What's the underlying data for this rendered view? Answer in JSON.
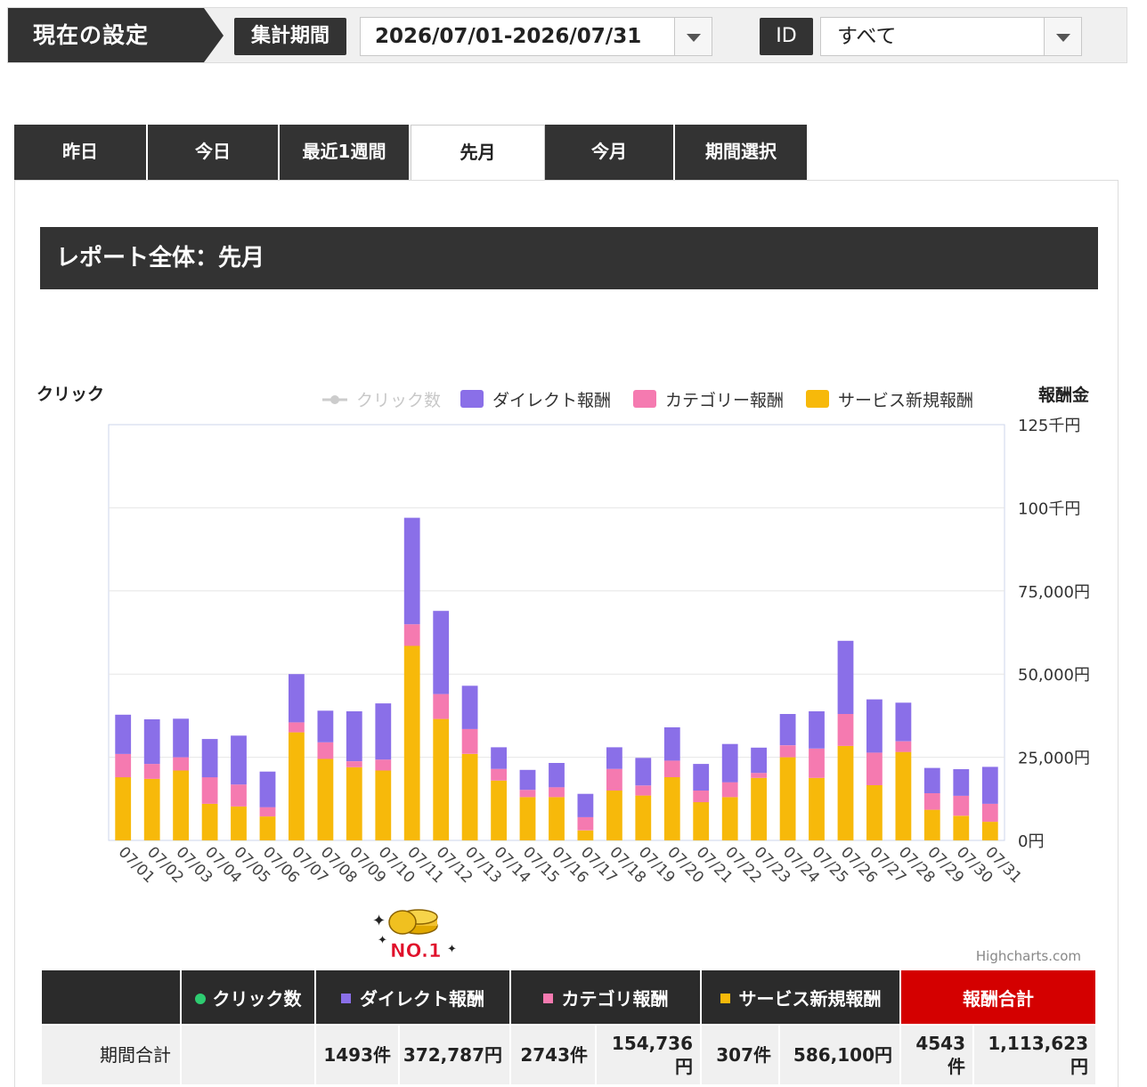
{
  "settings": {
    "current_label": "現在の設定",
    "period_label": "集計期間",
    "period_value": "2026/07/01-2026/07/31",
    "id_label": "ID",
    "id_value": "すべて"
  },
  "tabs": [
    {
      "label": "昨日",
      "active": false
    },
    {
      "label": "今日",
      "active": false
    },
    {
      "label": "最近1週間",
      "active": false
    },
    {
      "label": "先月",
      "active": true
    },
    {
      "label": "今月",
      "active": false
    },
    {
      "label": "期間選択",
      "active": false
    }
  ],
  "report_title": "レポート全体：先月",
  "colors": {
    "direct": "#8a6fe8",
    "category": "#f57ab0",
    "service": "#f7b90a",
    "clicks": "#bbbbbb"
  },
  "chart_data": {
    "type": "bar",
    "stacked": true,
    "left_axis_title": "クリック",
    "right_axis_title": "報酬金",
    "right_axis_ticks": [
      "0円",
      "25,000円",
      "50,000円",
      "75,000円",
      "100千円",
      "125千円"
    ],
    "ylim": [
      0,
      125000
    ],
    "grid": true,
    "legend_position": "top",
    "credit": "Highcharts.com",
    "categories": [
      "07/01",
      "07/02",
      "07/03",
      "07/04",
      "07/05",
      "07/06",
      "07/07",
      "07/08",
      "07/09",
      "07/10",
      "07/11",
      "07/12",
      "07/13",
      "07/14",
      "07/15",
      "07/16",
      "07/17",
      "07/18",
      "07/19",
      "07/20",
      "07/21",
      "07/22",
      "07/23",
      "07/24",
      "07/25",
      "07/26",
      "07/27",
      "07/28",
      "07/29",
      "07/30",
      "07/31"
    ],
    "series": [
      {
        "name": "クリック数",
        "type": "line",
        "hidden": true,
        "values": []
      },
      {
        "name": "サービス新規報酬",
        "values": [
          19000,
          18500,
          21000,
          11000,
          10200,
          7200,
          32500,
          24500,
          22000,
          21000,
          58500,
          36500,
          26000,
          18000,
          13000,
          13000,
          3000,
          15000,
          13500,
          19000,
          11500,
          13000,
          18800,
          25000,
          18800,
          28400,
          16600,
          26600,
          9200,
          7400,
          5600
        ]
      },
      {
        "name": "カテゴリー報酬",
        "values": [
          7000,
          4500,
          4000,
          8000,
          6600,
          2800,
          3000,
          5000,
          1800,
          3300,
          6500,
          7500,
          7500,
          3500,
          2200,
          3000,
          4000,
          6500,
          3000,
          5000,
          3500,
          4500,
          1500,
          3600,
          8800,
          9600,
          9800,
          3200,
          5000,
          6000,
          5400
        ]
      },
      {
        "name": "ダイレクト報酬",
        "values": [
          11800,
          13400,
          11600,
          11500,
          14700,
          10700,
          14500,
          9500,
          15000,
          16900,
          32000,
          25000,
          13000,
          6500,
          6000,
          7300,
          7000,
          6500,
          8300,
          10000,
          8000,
          11500,
          7600,
          9400,
          11200,
          22000,
          16000,
          11600,
          7600,
          8000,
          11100
        ]
      }
    ]
  },
  "summary": {
    "badge_text": "NO.1",
    "headers": [
      "",
      "クリック数",
      "ダイレクト報酬",
      "カテゴリ報酬",
      "サービス新規報酬",
      "報酬合計"
    ],
    "row_label": "期間合計",
    "clicks": "",
    "direct_count": "1493件",
    "direct_amount": "372,787円",
    "category_count": "2743件",
    "category_amount": "154,736円",
    "service_count": "307件",
    "service_amount": "586,100円",
    "total_count": "4543件",
    "total_amount": "1,113,623円"
  }
}
